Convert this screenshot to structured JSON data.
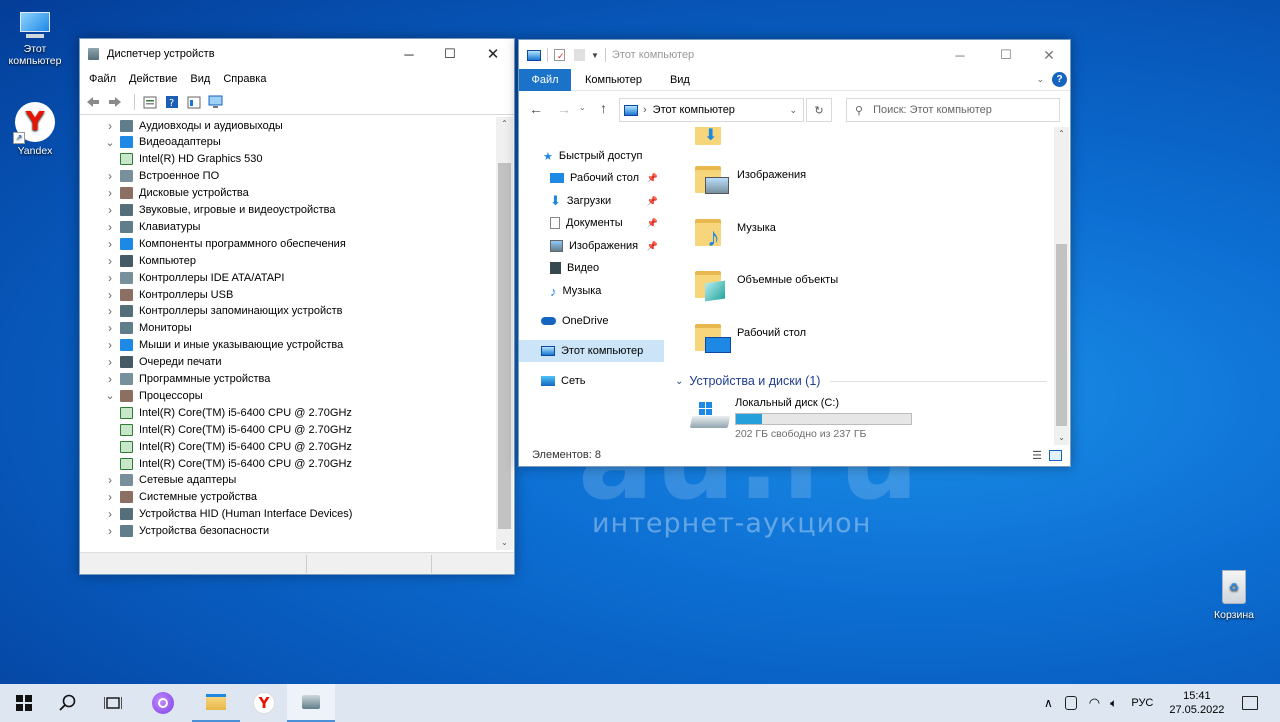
{
  "desktop": {
    "icons": [
      {
        "label": "Этот компьютер"
      },
      {
        "label": "Yandex"
      },
      {
        "label": "Корзина"
      }
    ],
    "watermark": {
      "logo": "au.ru",
      "tagline": "интернет-аукцион"
    }
  },
  "device_manager": {
    "title": "Диспетчер устройств",
    "menu": [
      "Файл",
      "Действие",
      "Вид",
      "Справка"
    ],
    "tree": [
      {
        "label": "Аудиовходы и аудиовыходы",
        "expanded": false,
        "child": false
      },
      {
        "label": "Видеоадаптеры",
        "expanded": true,
        "child": false
      },
      {
        "label": "Intel(R) HD Graphics 530",
        "expanded": false,
        "child": true
      },
      {
        "label": "Встроенное ПО",
        "expanded": false,
        "child": false
      },
      {
        "label": "Дисковые устройства",
        "expanded": false,
        "child": false
      },
      {
        "label": "Звуковые, игровые и видеоустройства",
        "expanded": false,
        "child": false
      },
      {
        "label": "Клавиатуры",
        "expanded": false,
        "child": false
      },
      {
        "label": "Компоненты программного обеспечения",
        "expanded": false,
        "child": false
      },
      {
        "label": "Компьютер",
        "expanded": false,
        "child": false
      },
      {
        "label": "Контроллеры IDE ATA/ATAPI",
        "expanded": false,
        "child": false
      },
      {
        "label": "Контроллеры USB",
        "expanded": false,
        "child": false
      },
      {
        "label": "Контроллеры запоминающих устройств",
        "expanded": false,
        "child": false
      },
      {
        "label": "Мониторы",
        "expanded": false,
        "child": false
      },
      {
        "label": "Мыши и иные указывающие устройства",
        "expanded": false,
        "child": false
      },
      {
        "label": "Очереди печати",
        "expanded": false,
        "child": false
      },
      {
        "label": "Программные устройства",
        "expanded": false,
        "child": false
      },
      {
        "label": "Процессоры",
        "expanded": true,
        "child": false
      },
      {
        "label": "Intel(R) Core(TM) i5-6400 CPU @ 2.70GHz",
        "expanded": false,
        "child": true
      },
      {
        "label": "Intel(R) Core(TM) i5-6400 CPU @ 2.70GHz",
        "expanded": false,
        "child": true
      },
      {
        "label": "Intel(R) Core(TM) i5-6400 CPU @ 2.70GHz",
        "expanded": false,
        "child": true
      },
      {
        "label": "Intel(R) Core(TM) i5-6400 CPU @ 2.70GHz",
        "expanded": false,
        "child": true
      },
      {
        "label": "Сетевые адаптеры",
        "expanded": false,
        "child": false
      },
      {
        "label": "Системные устройства",
        "expanded": false,
        "child": false
      },
      {
        "label": "Устройства HID (Human Interface Devices)",
        "expanded": false,
        "child": false
      },
      {
        "label": "Устройства безопасности",
        "expanded": false,
        "child": false
      }
    ]
  },
  "explorer": {
    "title": "Этот компьютер",
    "ribbon": {
      "file": "Файл",
      "tabs": [
        "Компьютер",
        "Вид"
      ]
    },
    "address": "Этот компьютер",
    "search_placeholder": "Поиск: Этот компьютер",
    "nav": {
      "quick_access": "Быстрый доступ",
      "pinned": [
        "Рабочий стол",
        "Загрузки",
        "Документы",
        "Изображения"
      ],
      "unpinned": [
        "Видео",
        "Музыка"
      ],
      "onedrive": "OneDrive",
      "this_pc": "Этот компьютер",
      "network": "Сеть"
    },
    "folders": [
      "Изображения",
      "Музыка",
      "Объемные объекты",
      "Рабочий стол"
    ],
    "devices_header": "Устройства и диски (1)",
    "drive": {
      "name": "Локальный диск (C:)",
      "free_text": "202 ГБ свободно из 237 ГБ",
      "used_fraction": 0.148
    },
    "status": "Элементов: 8"
  },
  "taskbar": {
    "language": "РУС",
    "time": "15:41",
    "date": "27.05.2022"
  },
  "colors": {
    "accent": "#1a73c9",
    "selection": "#cce4f7",
    "taskbar": "#dde6f1"
  }
}
